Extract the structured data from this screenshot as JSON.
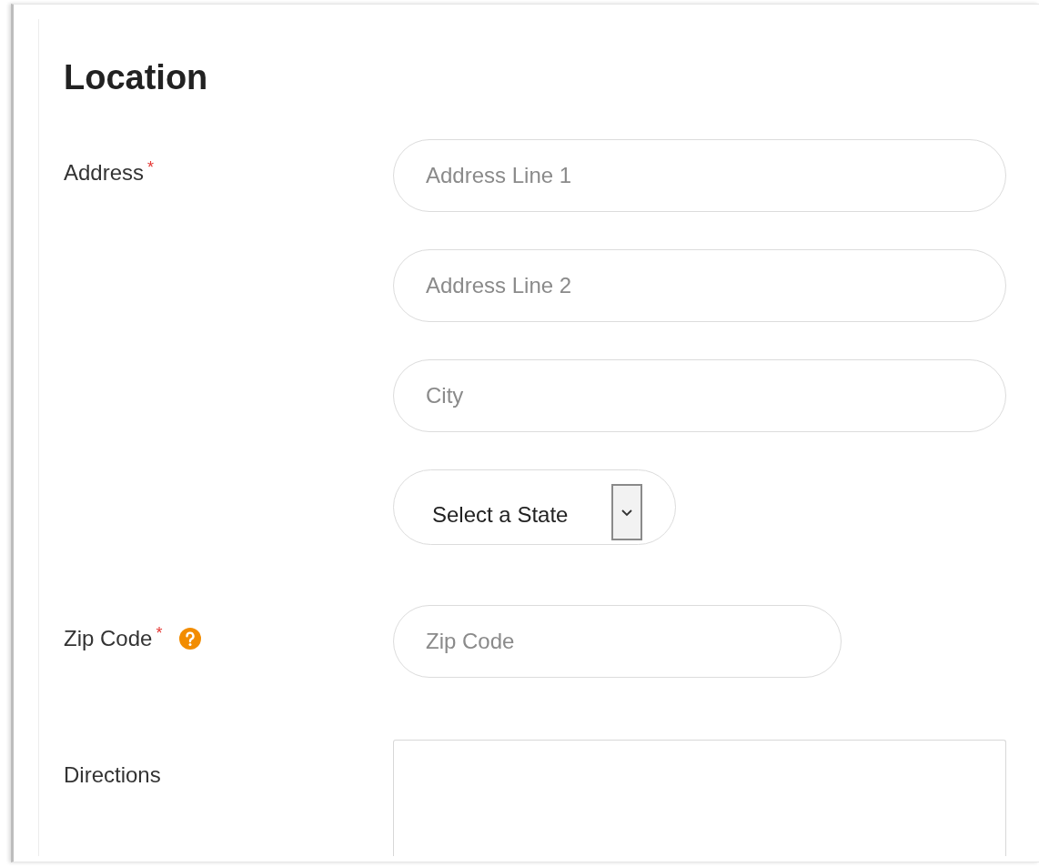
{
  "title": "Location",
  "fields": [
    {
      "label": "Address",
      "required_mark": "*",
      "help": false,
      "inputs": [
        {
          "kind": "text",
          "placeholder": "Address Line 1"
        },
        {
          "kind": "text",
          "placeholder": "Address Line 2"
        },
        {
          "kind": "text",
          "placeholder": "City"
        },
        {
          "kind": "select",
          "value": "Select a State"
        }
      ]
    },
    {
      "label": "Zip Code",
      "required_mark": "*",
      "help": true,
      "inputs": [
        {
          "kind": "short_text",
          "placeholder": "Zip Code"
        }
      ]
    },
    {
      "label": "Directions",
      "help": false,
      "inputs": [
        {
          "kind": "textarea"
        }
      ]
    }
  ]
}
